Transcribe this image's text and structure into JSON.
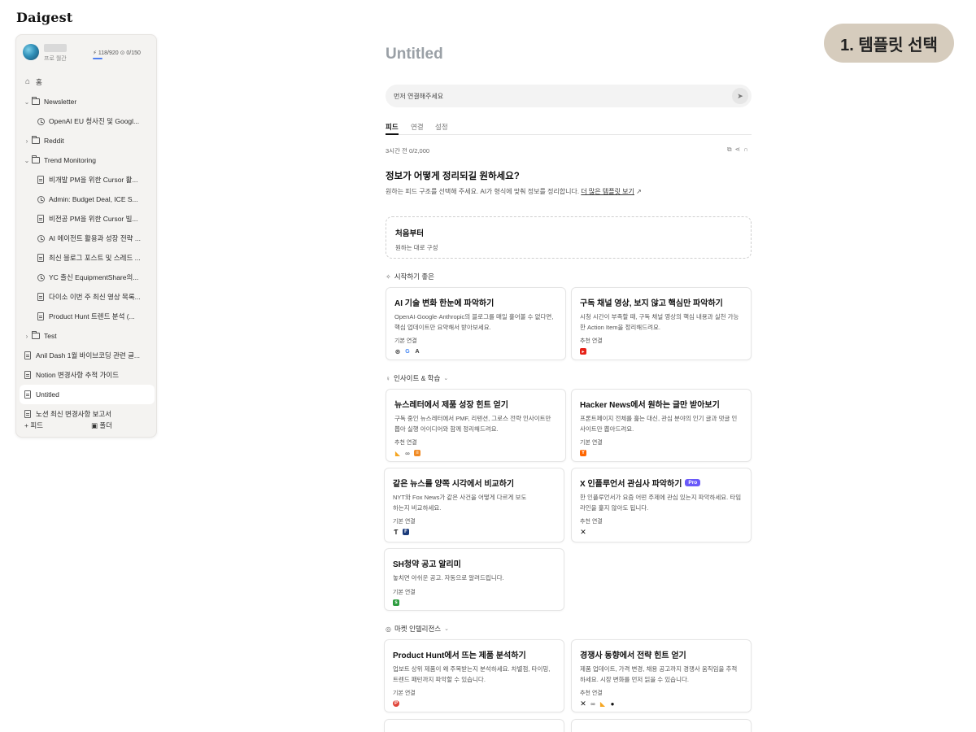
{
  "app": {
    "logo": "Daigest"
  },
  "step_badge": "1. 템플릿 선택",
  "sidebar": {
    "plan": "프로 월간",
    "credits": "⚡ 118/920  ⊙ 0/150",
    "items": [
      {
        "label": "홈",
        "type": "home",
        "level": 0
      },
      {
        "label": "Newsletter",
        "type": "folder-open",
        "level": 1
      },
      {
        "label": "OpenAI EU 청사진 및 Googl...",
        "type": "clock",
        "level": 2
      },
      {
        "label": "Reddit",
        "type": "folder-closed",
        "level": 1
      },
      {
        "label": "Trend Monitoring",
        "type": "folder-open",
        "level": 1
      },
      {
        "label": "비개발 PM을 위한 Cursor 활...",
        "type": "doc",
        "level": 2
      },
      {
        "label": "Admin: Budget Deal, ICE S...",
        "type": "clock",
        "level": 2
      },
      {
        "label": "비전공 PM을 위한 Cursor 빌...",
        "type": "doc",
        "level": 2
      },
      {
        "label": "AI 에이전트 활용과 성장 전략 ...",
        "type": "clock",
        "level": 2
      },
      {
        "label": "최신 블로그 포스트 및 스레드 ...",
        "type": "doc",
        "level": 2
      },
      {
        "label": "YC 출신 EquipmentShare의...",
        "type": "clock",
        "level": 2
      },
      {
        "label": "다이소 이번 주 최신 영상 목록...",
        "type": "doc",
        "level": 2
      },
      {
        "label": "Product Hunt 트렌드 분석 (...",
        "type": "doc",
        "level": 2
      },
      {
        "label": "Test",
        "type": "folder-closed",
        "level": 1
      },
      {
        "label": "Anil Dash 1월 바이브코딩 관련 글...",
        "type": "doc",
        "level": 0
      },
      {
        "label": "Notion 변경사항 추적 가이드",
        "type": "doc",
        "level": 0
      },
      {
        "label": "Untitled",
        "type": "doc",
        "level": 0,
        "active": true
      },
      {
        "label": "노션 최신 변경사항 보고서",
        "type": "doc",
        "level": 0
      }
    ],
    "add_feed": "+ 피드",
    "add_folder": "폴더"
  },
  "main": {
    "title": "Untitled",
    "connect_placeholder": "먼저 연결해주세요",
    "tabs": [
      "피드",
      "연결",
      "설정"
    ],
    "meta": "3시간 전   0/2,000",
    "question_title": "정보가 어떻게 정리되길 원하세요?",
    "question_sub": "원하는 피드 구조를 선택해 주세요. AI가 형식에 맞춰 정보를 정리합니다.",
    "more_templates": "더 많은 템플릿 보기",
    "scratch_title": "처음부터",
    "scratch_desc": "원하는 대로 구성",
    "sections": {
      "start": "시작하기 좋은",
      "insight": "인사이트 & 학습",
      "market": "마켓 인텔리전스"
    },
    "cards": [
      {
        "title": "AI 기술 변화 한눈에 파악하기",
        "desc": "OpenAI·Google·Anthropic의 블로그를 매일 훑어볼 수 없다면, 핵심 업데이트만 요약해서 받아보세요.",
        "conn": "기본 연결"
      },
      {
        "title": "구독 채널 영상, 보지 않고 핵심만 파악하기",
        "desc": "시청 시간이 부족할 때, 구독 채널 영상의 핵심 내용과 실천 가능한 Action Item을 정리해드려요.",
        "conn": "추천 연결"
      },
      {
        "title": "뉴스레터에서 제품 성장 힌트 얻기",
        "desc": "구독 중인 뉴스레터에서 PMF, 리텐션, 그로스 전략 인사이트만 뽑아 실행 아이디어와 함께 정리해드려요.",
        "conn": "추천 연결"
      },
      {
        "title": "Hacker News에서 원하는 글만 받아보기",
        "desc": "프론트페이지 전체를 훑는 대신, 관심 분야의 인기 글과 댓글 인사이트만 뽑아드려요.",
        "conn": "기본 연결"
      },
      {
        "title": "같은 뉴스를 양쪽 시각에서 비교하기",
        "desc": "NYT와 Fox News가 같은 사건을 어떻게 다르게 보도하는지 비교하세요.",
        "conn": "기본 연결"
      },
      {
        "title": "X 인플루언서 관심사 파악하기",
        "desc": "한 인플루언서가 요즘 어떤 주제에 관심 있는지 파악하세요. 타임라인을 훑지 않아도 됩니다.",
        "conn": "추천 연결",
        "badge": "Pro"
      },
      {
        "title": "SH청약 공고 알리미",
        "desc": "놓치면 아쉬운 공고. 자동으로 알려드립니다.",
        "conn": "기본 연결"
      },
      {
        "title": "Product Hunt에서 뜨는 제품 분석하기",
        "desc": "업보트 상위 제품이 왜 주목받는지 분석하세요. 차별점, 타이밍, 트렌드 패턴까지 파악할 수 있습니다.",
        "conn": "기본 연결"
      },
      {
        "title": "경쟁사 동향에서 전략 힌트 얻기",
        "desc": "제품 업데이트, 가격 변경, 채용 공고까지 경쟁사 움직임을 추적하세요. 시장 변화를 먼저 읽을 수 있습니다.",
        "conn": "추천 연결"
      }
    ]
  },
  "colors": {
    "accent": "#6a5af9",
    "badge_bg": "#d6ccbd",
    "youtube": "#e62117",
    "hn": "#ff6600",
    "rss": "#f5a623",
    "green": "#2e9d3f",
    "red": "#e0453a"
  }
}
